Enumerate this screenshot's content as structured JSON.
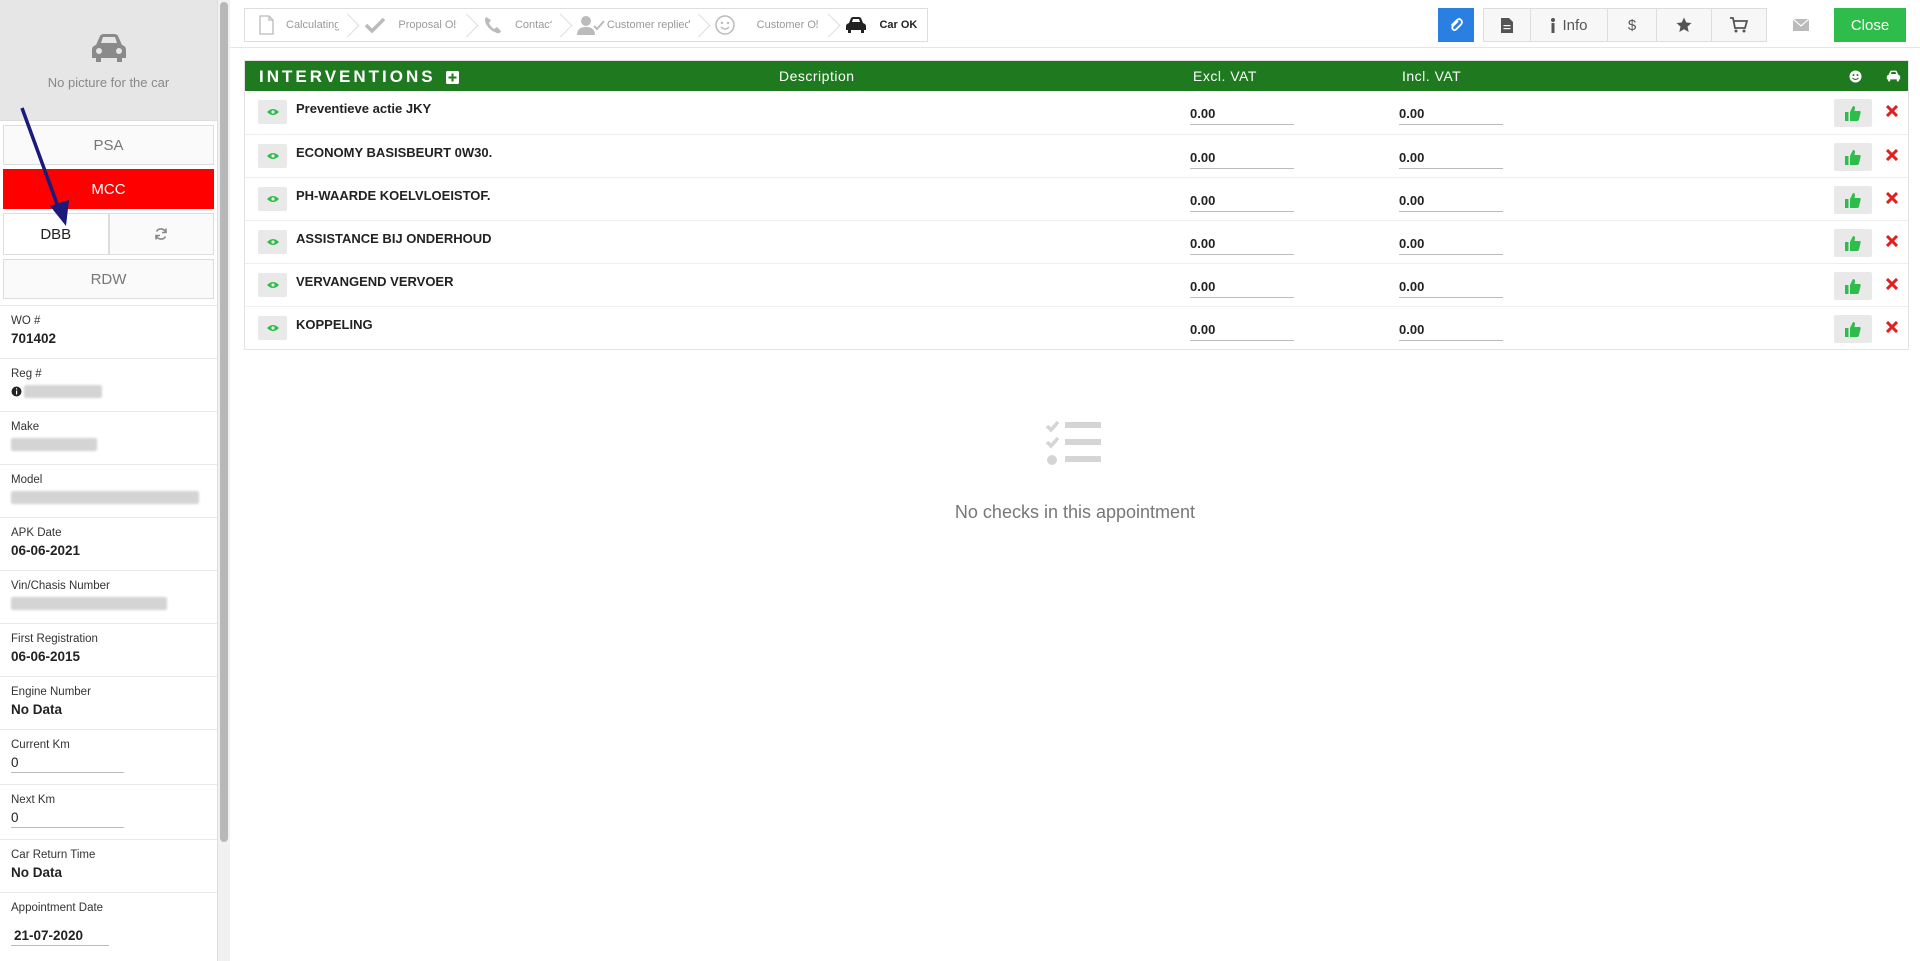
{
  "sidebar": {
    "no_picture": "No picture for the car",
    "buttons": {
      "psa": "PSA",
      "mcc": "MCC",
      "dbb": "DBB",
      "rdw": "RDW"
    },
    "fields": {
      "wo_label": "WO #",
      "wo_value": "701402",
      "reg_label": "Reg #",
      "make_label": "Make",
      "model_label": "Model",
      "apk_label": "APK Date",
      "apk_value": "06-06-2021",
      "vin_label": "Vin/Chasis Number",
      "first_reg_label": "First Registration",
      "first_reg_value": "06-06-2015",
      "engine_label": "Engine Number",
      "engine_value": "No Data",
      "current_km_label": "Current Km",
      "current_km_value": "0",
      "next_km_label": "Next Km",
      "next_km_value": "0",
      "return_label": "Car Return Time",
      "return_value": "No Data",
      "appointment_label": "Appointment Date",
      "appointment_value": "21-07-2020"
    },
    "colors": {
      "mcc": "#ff0000"
    }
  },
  "steps": [
    {
      "label": "Calculating",
      "icon": "file-icon"
    },
    {
      "label": "Proposal Ok",
      "icon": "check-icon"
    },
    {
      "label": "Contact",
      "icon": "phone-icon"
    },
    {
      "label": "Customer replied",
      "icon": "user-check-icon"
    },
    {
      "label": "Customer Ok",
      "icon": "smile-icon"
    },
    {
      "label": "Car OK",
      "icon": "car-icon"
    }
  ],
  "toolbar": {
    "info": "Info",
    "dollar": "$",
    "close": "Close"
  },
  "interventions": {
    "title": "INTERVENTIONS",
    "columns": {
      "description": "Description",
      "excl": "Excl. VAT",
      "incl": "Incl. VAT"
    },
    "rows": [
      {
        "name": "Preventieve actie JKY",
        "excl": "0.00",
        "incl": "0.00"
      },
      {
        "name": "ECONOMY BASISBEURT 0W30.",
        "excl": "0.00",
        "incl": "0.00"
      },
      {
        "name": "PH-WAARDE KOELVLOEISTOF.",
        "excl": "0.00",
        "incl": "0.00"
      },
      {
        "name": "ASSISTANCE BIJ ONDERHOUD",
        "excl": "0.00",
        "incl": "0.00"
      },
      {
        "name": "VERVANGEND VERVOER",
        "excl": "0.00",
        "incl": "0.00"
      },
      {
        "name": "KOPPELING",
        "excl": "0.00",
        "incl": "0.00"
      }
    ],
    "header_color": "#1f7a1f"
  },
  "empty_checks": "No checks in this appointment"
}
